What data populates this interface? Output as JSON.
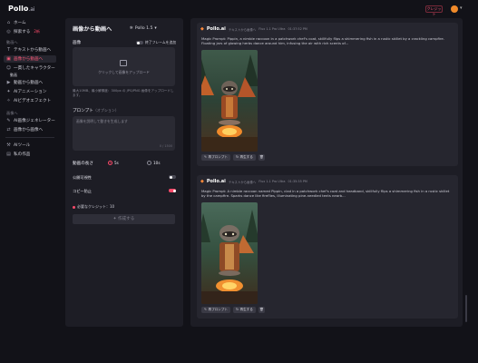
{
  "app": {
    "logo_main": "Pollo",
    "logo_suffix": ".ai"
  },
  "topbar": {
    "credits_label": "クレジット",
    "avatar_letter": ""
  },
  "sidebar": {
    "home": "ホーム",
    "explore": "探索する",
    "explore_badge": "2新",
    "section_video": "動画へ",
    "text_to_video": "テキストから動画へ",
    "image_to_video": "画像から動画へ",
    "consistent_char": "一貫したキャラクター",
    "consistent_char_sub": "動画",
    "video_to_video": "動画から動画へ",
    "ai_animation": "AIアニメーション",
    "ai_video_effects": "AIビデオエフェクト",
    "section_image": "画像へ",
    "ai_image_gen": "AI画像ジェネレーター",
    "image_to_image": "画像から画像へ",
    "ai_tools": "AIツール",
    "my_creations": "私の作品"
  },
  "panel": {
    "title": "画像から動画へ",
    "model": "Pollo 1.5",
    "image_label": "画像",
    "end_frame_label": "終了フレームを追加",
    "upload_text": "クリックして画像をアップロード",
    "upload_hint": "最大10MB、最小解像度：300px の JPG/PNG 画像をアップロードします。",
    "prompt_label": "プロンプト",
    "prompt_optional": "（オプション）",
    "prompt_placeholder": "画像を説明して動きを生成します",
    "prompt_count": "0 / 1500",
    "length_label": "動画の長さ",
    "length_5": "5s",
    "length_10": "10s",
    "public_label": "公開可視性",
    "copy_protect_label": "コピー防止",
    "credit_note": "必要なクレジット：10",
    "create_label": "作成する"
  },
  "results": [
    {
      "brand": "Pollo.ai",
      "meta_type": "テキストから画像へ",
      "meta_model": "Flux 1.1 Pro Ultra",
      "meta_time": "01:37:52 PM",
      "prompt": "Magic Prompt: Pippin, a nimble raccoon in a patchwork chef's coat, skillfully flips a shimmering fish in a rustic skillet by a crackling campfire. Floating jars of glowing herbs dance around him, infusing the air with rich scents of...",
      "btn_reuse": "再プロンプト",
      "btn_regen": "再生する"
    },
    {
      "brand": "Pollo.ai",
      "meta_type": "テキストから画像へ",
      "meta_model": "Flux 1.1 Pro Ultra",
      "meta_time": "01:35:35 PM",
      "prompt": "Magic Prompt: A nimble raccoon named Pippin, clad in a patchwork chef's coat and headband, skillfully flips a shimmering fish in a rustic skillet by the campfire. Sparks dance like fireflies, illuminating pine-needled tents nearb...",
      "btn_reuse": "再プロンプト",
      "btn_regen": "再生する"
    }
  ],
  "colors": {
    "accent": "#ff4a6a",
    "bg": "#121218",
    "panel": "#1d1d25",
    "card": "#26262f"
  }
}
